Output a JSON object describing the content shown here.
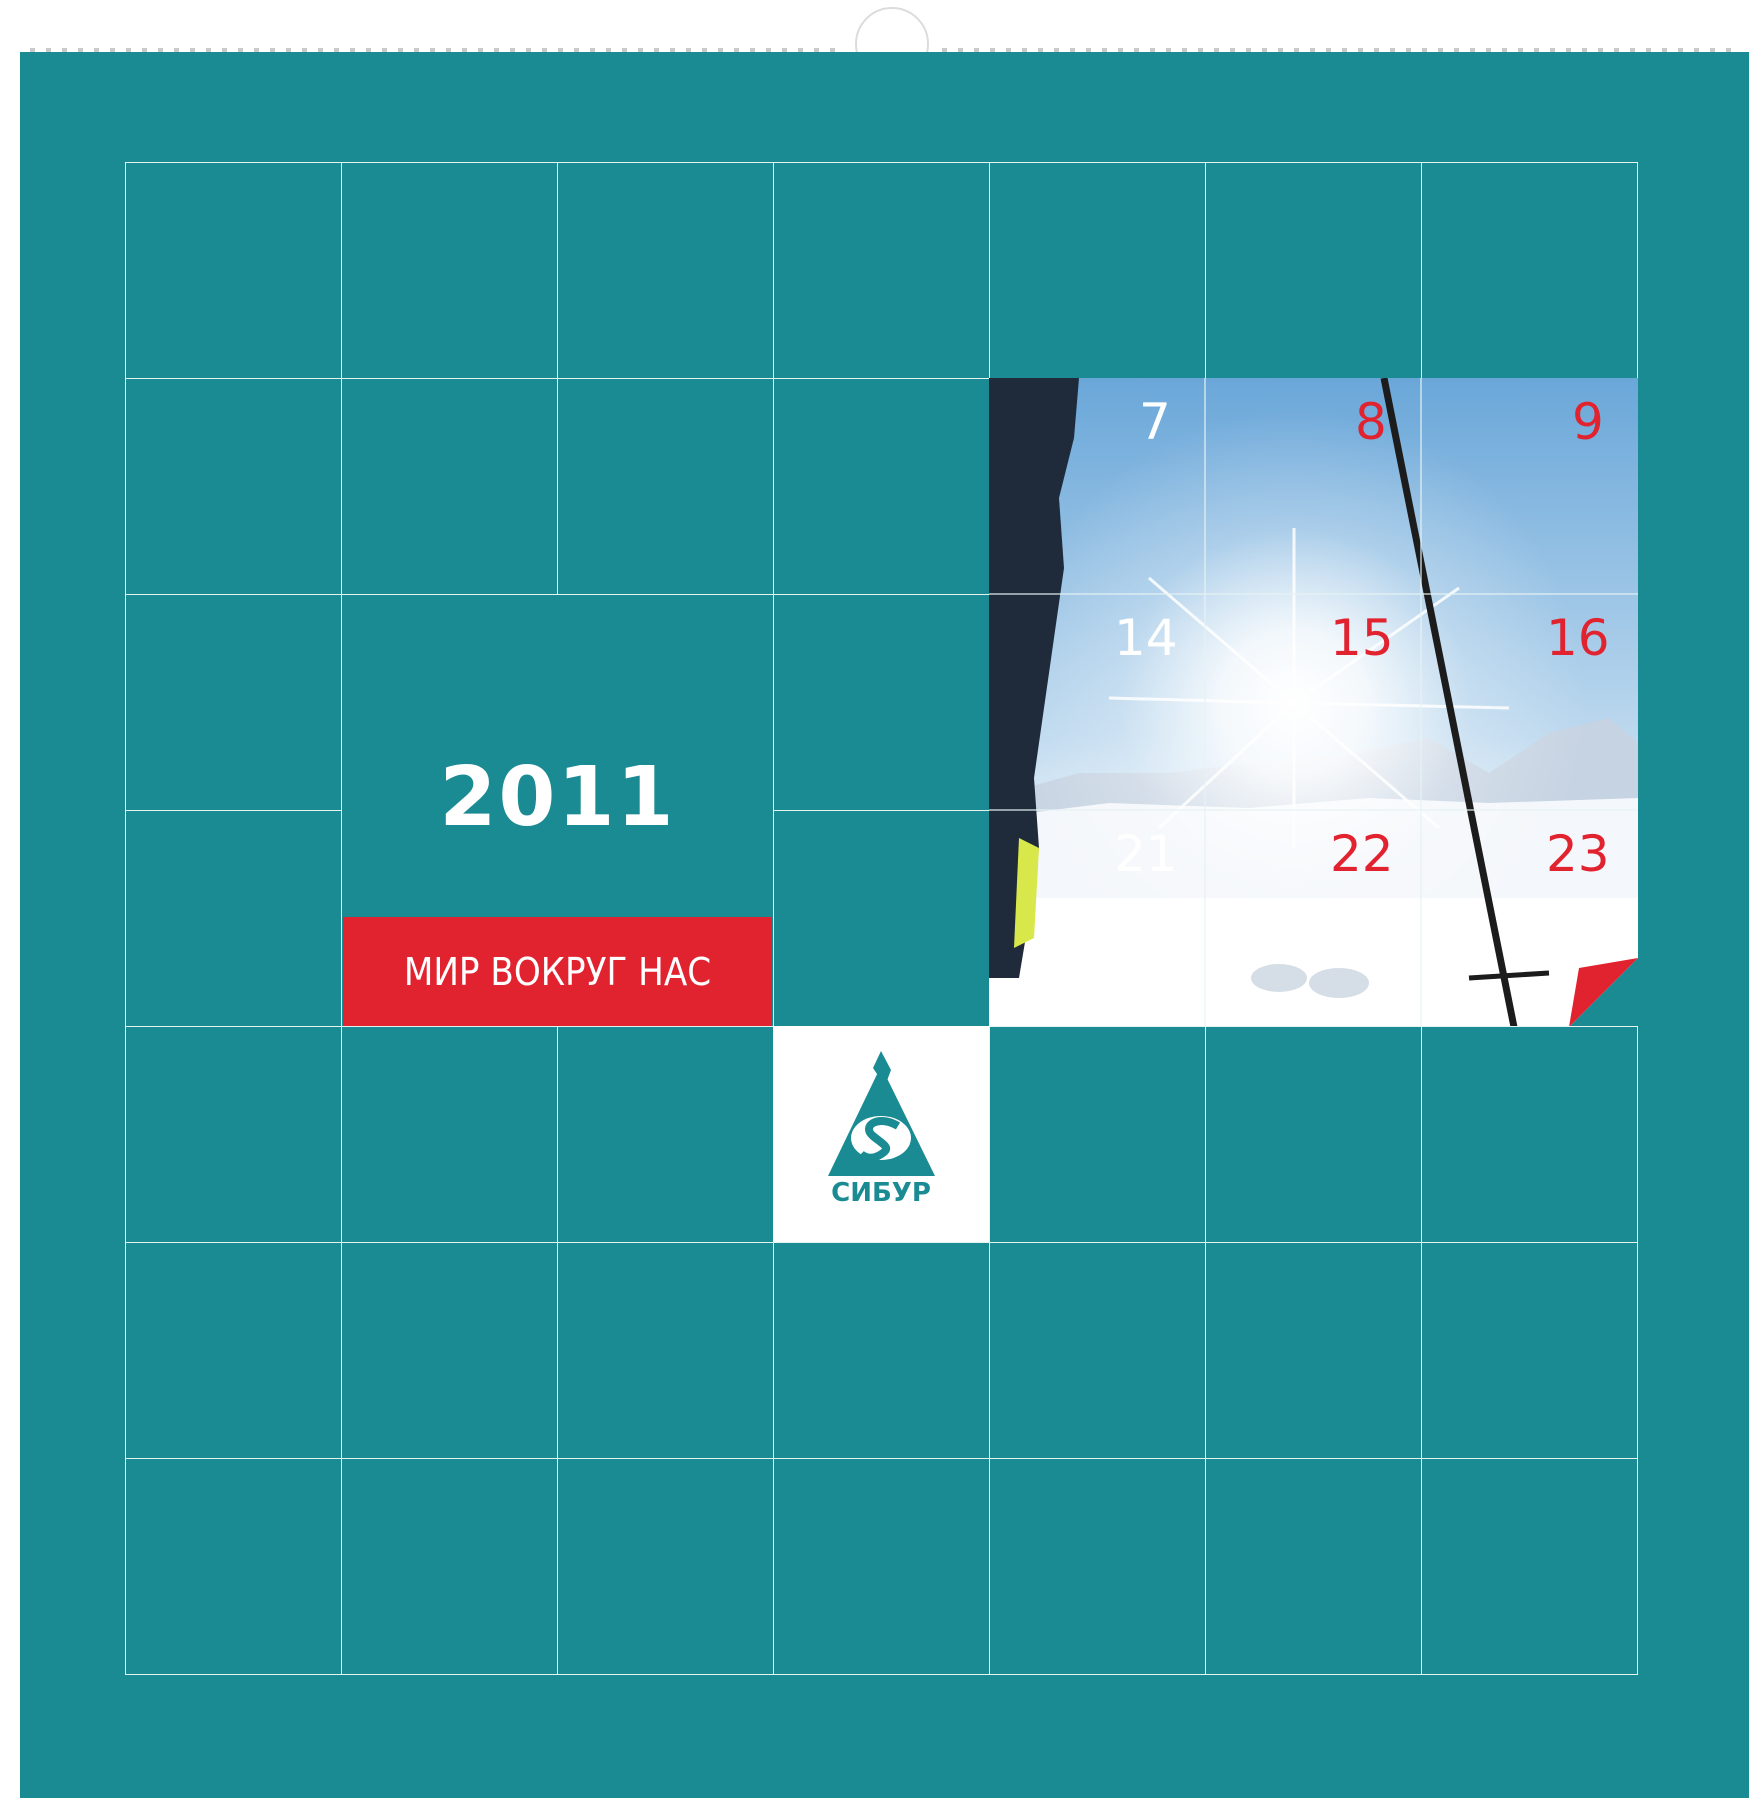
{
  "calendar": {
    "year": "2011",
    "theme_title": "МИР ВОКРУГ НАС",
    "logo_text": "СИБУР",
    "photo_days": [
      {
        "label": "7",
        "style": "white"
      },
      {
        "label": "8",
        "style": "red"
      },
      {
        "label": "9",
        "style": "red"
      },
      {
        "label": "14",
        "style": "white"
      },
      {
        "label": "15",
        "style": "red"
      },
      {
        "label": "16",
        "style": "red"
      },
      {
        "label": "21",
        "style": "white"
      },
      {
        "label": "22",
        "style": "red"
      },
      {
        "label": "23",
        "style": "red"
      }
    ]
  },
  "colors": {
    "background_teal": "#1a8b93",
    "accent_red": "#e1232f",
    "grid_line": "#e6f3f3",
    "logo_teal": "#1a8b93"
  }
}
